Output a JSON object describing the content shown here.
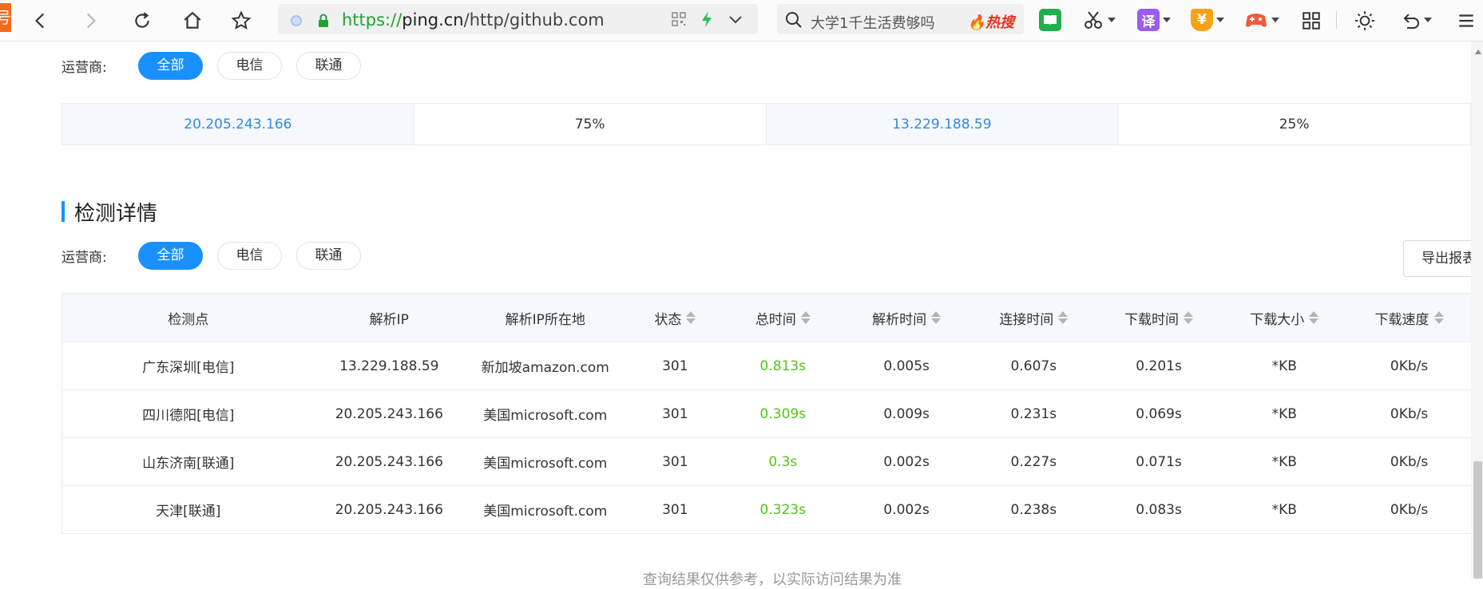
{
  "browser": {
    "left_tab_glyph": "号",
    "address": {
      "scheme": "https://",
      "host": "ping.cn",
      "path": "/http/github.com"
    },
    "search": {
      "placeholder": "大学1千生活费够吗",
      "hot_label": "热搜"
    },
    "extensions": {
      "translate_label": "译",
      "coupon_label": "¥"
    },
    "icons": [
      "back-icon",
      "forward-icon",
      "refresh-icon",
      "home-icon",
      "star-icon",
      "qr-icon",
      "bolt-icon",
      "chevron-down-icon",
      "search-icon",
      "flame-icon",
      "book-icon",
      "scissors-icon",
      "translate-icon",
      "coupon-icon",
      "game-icon",
      "grid-icon",
      "brightness-icon",
      "undo-icon",
      "menu-icon"
    ]
  },
  "filter_top": {
    "label": "运营商:",
    "options": [
      "全部",
      "电信",
      "联通"
    ],
    "active": "全部"
  },
  "ip_ratio": [
    {
      "ip": "20.205.243.166",
      "percent": "75%"
    },
    {
      "ip": "13.229.188.59",
      "percent": "25%"
    }
  ],
  "section": {
    "title": "检测详情",
    "export_label": "导出报表"
  },
  "filter_detail": {
    "label": "运营商:",
    "options": [
      "全部",
      "电信",
      "联通"
    ],
    "active": "全部"
  },
  "table": {
    "headers": [
      "检测点",
      "解析IP",
      "解析IP所在地",
      "状态",
      "总时间",
      "解析时间",
      "连接时间",
      "下载时间",
      "下载大小",
      "下载速度"
    ],
    "rows": [
      [
        "广东深圳[电信]",
        "13.229.188.59",
        "新加坡amazon.com",
        "301",
        "0.813s",
        "0.005s",
        "0.607s",
        "0.201s",
        "*KB",
        "0Kb/s"
      ],
      [
        "四川德阳[电信]",
        "20.205.243.166",
        "美国microsoft.com",
        "301",
        "0.309s",
        "0.009s",
        "0.231s",
        "0.069s",
        "*KB",
        "0Kb/s"
      ],
      [
        "山东济南[联通]",
        "20.205.243.166",
        "美国microsoft.com",
        "301",
        "0.3s",
        "0.002s",
        "0.227s",
        "0.071s",
        "*KB",
        "0Kb/s"
      ],
      [
        "天津[联通]",
        "20.205.243.166",
        "美国microsoft.com",
        "301",
        "0.323s",
        "0.002s",
        "0.238s",
        "0.083s",
        "*KB",
        "0Kb/s"
      ]
    ]
  },
  "footnote": "查询结果仅供参考，以实际访问结果为准",
  "colors": {
    "accent": "#1890ff",
    "ip_link": "#2f8ae3",
    "fast_time": "#52c41a",
    "url_scheme": "#21a336",
    "hot": "#e8321c"
  }
}
